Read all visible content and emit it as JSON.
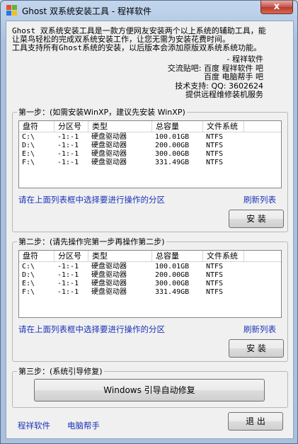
{
  "window": {
    "title": "Ghost 双系统安装工具 - 程祥软件",
    "close_label": "x"
  },
  "intro": {
    "lines": [
      "Ghost 双系统安装工具是一款方便网友安装两个以上系统的辅助工具，能",
      "让菜鸟轻松的完成双系统安装工作，让您无需为安装花费时间。",
      "工具支持所有Ghost系统的安装，以后版本会添加原版双系统系统功能。"
    ]
  },
  "credits": {
    "lines": [
      "- 程祥软件",
      "交流贴吧: 百度 程祥软件 吧",
      "百度 电脑帮手 吧",
      "技术支持: QQ: 3602624",
      "提供远程维修装机服务"
    ]
  },
  "columns": [
    "盘符",
    "分区号",
    "类型",
    "总容量",
    "文件系统"
  ],
  "step1": {
    "title": "第一步：(如需安装WinXP，建议先安装 WinXP)",
    "rows": [
      [
        "C:\\",
        "-1:-1",
        "硬盘驱动器",
        "100.01GB",
        "NTFS"
      ],
      [
        "D:\\",
        "-1:-1",
        "硬盘驱动器",
        "200.00GB",
        "NTFS"
      ],
      [
        "E:\\",
        "-1:-1",
        "硬盘驱动器",
        "300.00GB",
        "NTFS"
      ],
      [
        "F:\\",
        "-1:-1",
        "硬盘驱动器",
        "331.49GB",
        "NTFS"
      ]
    ],
    "hint": "请在上面列表框中选择要进行操作的分区",
    "refresh": "刷新列表",
    "install": "安 装"
  },
  "step2": {
    "title": "第二步：(请先操作完第一步再操作第二步)",
    "rows": [
      [
        "C:\\",
        "-1:-1",
        "硬盘驱动器",
        "100.01GB",
        "NTFS"
      ],
      [
        "D:\\",
        "-1:-1",
        "硬盘驱动器",
        "200.00GB",
        "NTFS"
      ],
      [
        "E:\\",
        "-1:-1",
        "硬盘驱动器",
        "300.00GB",
        "NTFS"
      ],
      [
        "F:\\",
        "-1:-1",
        "硬盘驱动器",
        "331.49GB",
        "NTFS"
      ]
    ],
    "hint": "请在上面列表框中选择要进行操作的分区",
    "refresh": "刷新列表",
    "install": "安 装"
  },
  "step3": {
    "title": "第三步：(系统引导修复)",
    "repair": "Windows 引导自动修复"
  },
  "footer": {
    "link1": "程祥软件",
    "link2": "电脑帮手",
    "exit": "退 出"
  }
}
